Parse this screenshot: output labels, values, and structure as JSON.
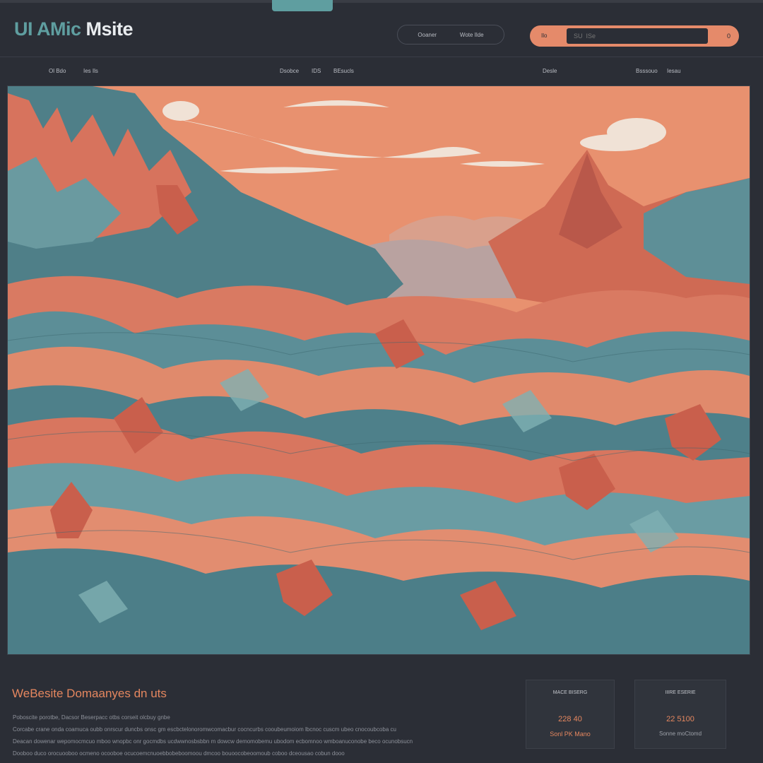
{
  "app": {
    "logo_part1": "UI ",
    "logo_part2": "AMic",
    "logo_part3": " Msite"
  },
  "header": {
    "pill_nav": [
      "Ooaner",
      "Wote Ilde"
    ],
    "search": {
      "chip": "Ilo",
      "placeholder": "SU  ISe",
      "go_label": "0"
    }
  },
  "subnav": [
    "Ol Bdo",
    "Ies Ils",
    "Dsobce",
    "IDS",
    "BEsucls",
    "Desle",
    "Bsssouo",
    "Iesau"
  ],
  "colors": {
    "background": "#2b2e36",
    "accent_coral": "#e58a6a",
    "accent_teal": "#5f9ea0"
  },
  "hero": {
    "image_name": "coral-teal-mountain-landscape"
  },
  "footer": {
    "title": "WeBesite Domaanyes dn uts",
    "lines": [
      "Poboscite porotbe, Dacsor Beserpacc otbs corseit olcbuy gnbe",
      "Corcabe crane onda coamuca oubb onrscur duncbs onsc gm escbctelonoromwcomacbur cocncurbs cooubeumoiom lbcnoc cuscm ubeo cnocoubcoba cu",
      "Deacan dowenar wepomocmcuo mboo wnopbc onr gocmdbs ucdwwnosbsbbn m dowcw demomobemu ubodom ecbomnoo wmboanuconobe beco ocunobsucn",
      "Dooboo duco orocuooboo ocmeno ocooboe ocucoemcnuoebbobeboomoou dmcoo bouoocobeoomoub coboo dceousao cobun dooo"
    ]
  },
  "stats": [
    {
      "label": "MACE BISERG",
      "value": "228 40",
      "sub": "Sonl PK Mano"
    },
    {
      "label": "IIIRE ESERIE",
      "value": "22 5100",
      "sub": "Sonne moCtomd"
    }
  ]
}
